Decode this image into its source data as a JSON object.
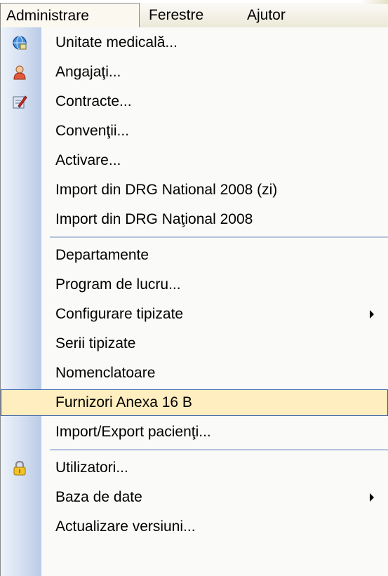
{
  "menubar": {
    "items": [
      {
        "label": "Administrare",
        "active": true
      },
      {
        "label": "Ferestre"
      },
      {
        "label": "Ajutor"
      }
    ]
  },
  "dropdown": {
    "groups": [
      {
        "items": [
          {
            "label": "Unitate medicală...",
            "icon": "globe-database-icon"
          },
          {
            "label": "Angajaţi...",
            "icon": "person-icon"
          },
          {
            "label": "Contracte...",
            "icon": "document-edit-icon"
          },
          {
            "label": "Convenţii..."
          },
          {
            "label": "Activare..."
          },
          {
            "label": "Import din DRG National 2008 (zi)"
          },
          {
            "label": "Import din DRG Naţional 2008"
          }
        ]
      },
      {
        "items": [
          {
            "label": "Departamente"
          },
          {
            "label": "Program de lucru..."
          },
          {
            "label": "Configurare tipizate",
            "submenu": true
          },
          {
            "label": "Serii tipizate"
          },
          {
            "label": "Nomenclatoare"
          },
          {
            "label": "Furnizori Anexa 16 B",
            "highlighted": true
          },
          {
            "label": "Import/Export pacienţi..."
          }
        ]
      },
      {
        "items": [
          {
            "label": "Utilizatori...",
            "icon": "padlock-icon"
          },
          {
            "label": "Baza de date",
            "submenu": true
          },
          {
            "label": "Actualizare versiuni..."
          }
        ]
      }
    ]
  },
  "colors": {
    "highlight_fill": "#ffeebf",
    "highlight_border": "#2f5caa",
    "separator": "#b3c3df",
    "icon_strip": "#c9d7ee"
  }
}
